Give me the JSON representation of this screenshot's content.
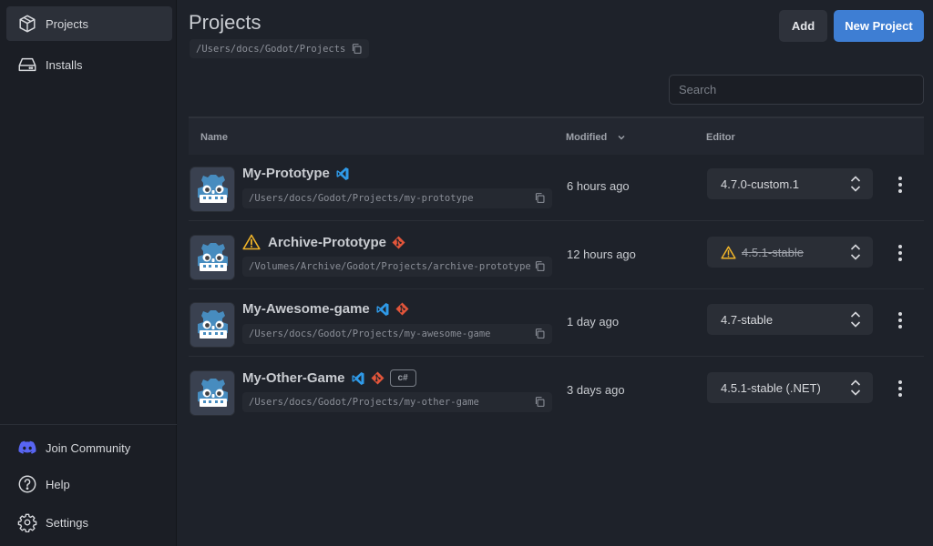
{
  "sidebar": {
    "items": [
      {
        "label": "Projects",
        "icon": "box-icon",
        "active": true
      },
      {
        "label": "Installs",
        "icon": "drive-icon",
        "active": false
      }
    ],
    "bottom": [
      {
        "label": "Join Community",
        "icon": "discord-icon"
      },
      {
        "label": "Help",
        "icon": "help-icon"
      },
      {
        "label": "Settings",
        "icon": "gear-icon"
      }
    ]
  },
  "header": {
    "title": "Projects",
    "path": "/Users/docs/Godot/Projects",
    "add_label": "Add",
    "new_label": "New Project"
  },
  "search": {
    "placeholder": "Search",
    "value": ""
  },
  "table": {
    "columns": {
      "name": "Name",
      "modified": "Modified",
      "editor": "Editor"
    },
    "rows": [
      {
        "name": "My-Prototype",
        "path": "/Users/docs/Godot/Projects/my-prototype",
        "modified": "6 hours ago",
        "editor": "4.7.0-custom.1",
        "badges": [
          "vscode-icon"
        ],
        "warning": false,
        "editor_missing": false
      },
      {
        "name": "Archive-Prototype",
        "path": "/Volumes/Archive/Godot/Projects/archive-prototype",
        "modified": "12 hours ago",
        "editor": "4.5.1-stable",
        "badges": [
          "git-icon"
        ],
        "warning": true,
        "editor_missing": true
      },
      {
        "name": "My-Awesome-game",
        "path": "/Users/docs/Godot/Projects/my-awesome-game",
        "modified": "1 day ago",
        "editor": "4.7-stable",
        "badges": [
          "vscode-icon",
          "git-icon"
        ],
        "warning": false,
        "editor_missing": false
      },
      {
        "name": "My-Other-Game",
        "path": "/Users/docs/Godot/Projects/my-other-game",
        "modified": "3 days ago",
        "editor": "4.5.1-stable (.NET)",
        "badges": [
          "vscode-icon",
          "git-icon"
        ],
        "csharp_label": "c#",
        "warning": false,
        "editor_missing": false
      }
    ]
  },
  "colors": {
    "accent": "#3e7ed3",
    "background": "#1e222a",
    "sidebar": "#1b1e25",
    "vscode": "#2f9ae8",
    "git": "#e2553a",
    "warning": "#f0b429",
    "discord": "#5865f2"
  }
}
